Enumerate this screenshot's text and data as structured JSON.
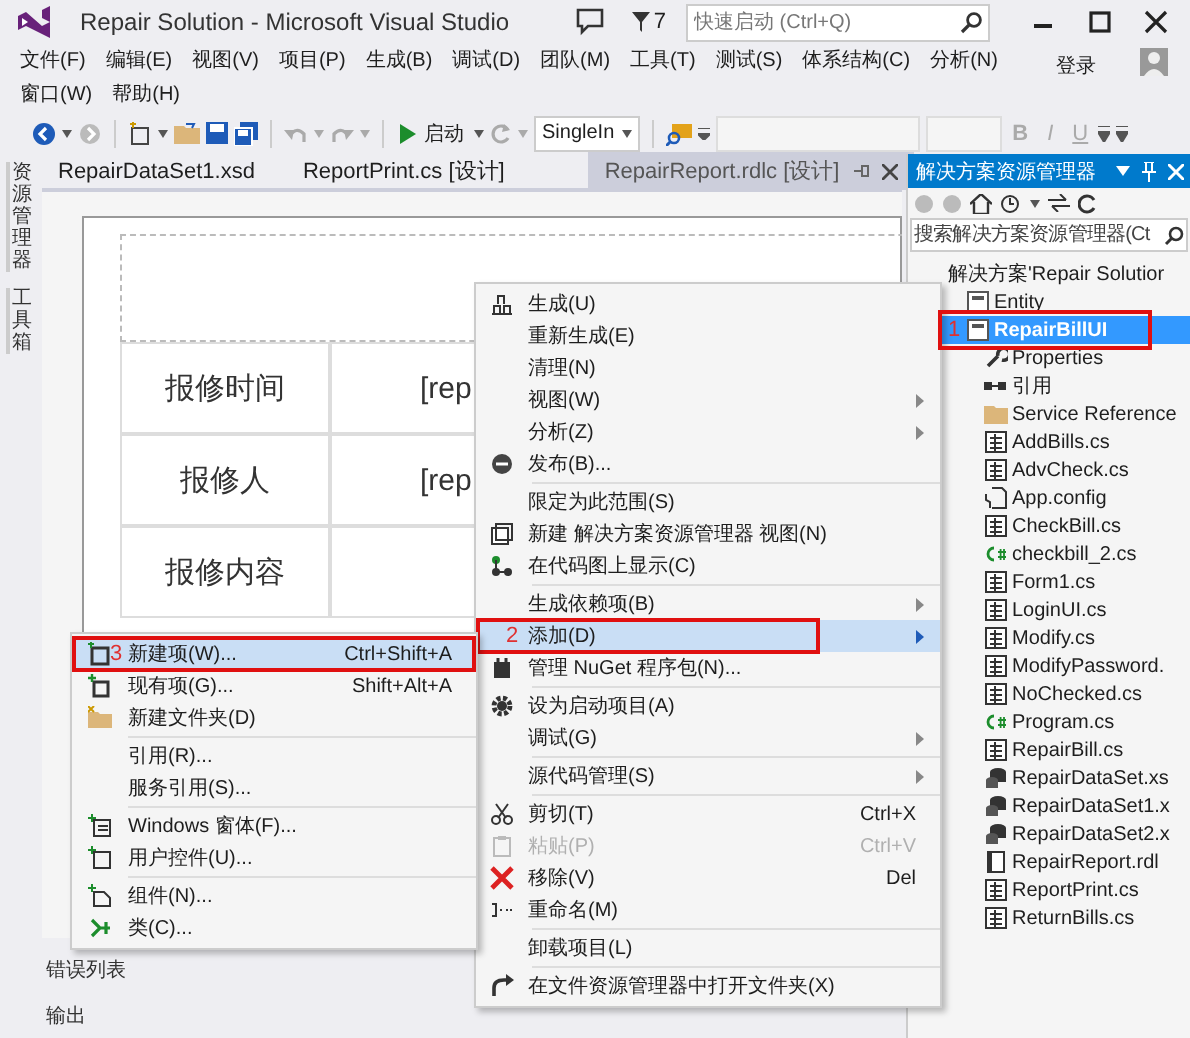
{
  "window": {
    "title": "Repair Solution - Microsoft Visual Studio",
    "notification_count": "7",
    "quick_launch": {
      "placeholder": "快速启动 (Ctrl+Q)"
    }
  },
  "menu_bar": [
    "文件(F)",
    "编辑(E)",
    "视图(V)",
    "项目(P)",
    "生成(B)",
    "调试(D)",
    "团队(M)",
    "工具(T)",
    "测试(S)",
    "体系结构(C)",
    "分析(N)",
    "窗口(W)",
    "帮助(H)"
  ],
  "sign_in": "登录",
  "toolbar": {
    "start_label": "启动",
    "configuration": "SingleIn",
    "format_buttons": [
      "B",
      "I",
      "U"
    ]
  },
  "side_tabs": [
    "资源管理器",
    "工具箱"
  ],
  "document_tabs": [
    {
      "label": "RepairDataSet1.xsd",
      "selected": false
    },
    {
      "label": "ReportPrint.cs [设计]",
      "selected": false
    },
    {
      "label": "RepairReport.rdlc [设计]",
      "selected": true
    }
  ],
  "report": {
    "rows": [
      {
        "label": "报修时间",
        "value": "[rep"
      },
      {
        "label": "报修人",
        "value": "[rep"
      },
      {
        "label": "报修内容"
      }
    ]
  },
  "bottom_panels": [
    "错误列表",
    "输出"
  ],
  "solution_explorer": {
    "title": "解决方案资源管理器",
    "search": {
      "placeholder": "搜索解决方案资源管理器(Ct"
    },
    "tree": [
      {
        "label": "解决方案'Repair Solutior",
        "selected": false,
        "children": [
          {
            "kind": "project",
            "label": "Entity",
            "selected": false
          },
          {
            "kind": "project",
            "label": "RepairBillUI",
            "selected": true,
            "marker": "1",
            "children": [
              {
                "kind": "properties",
                "label": "Properties",
                "selected": false
              },
              {
                "kind": "references",
                "label": "引用",
                "selected": false
              },
              {
                "kind": "folder",
                "label": "Service Reference",
                "selected": false
              },
              {
                "kind": "form",
                "label": "AddBills.cs",
                "selected": false
              },
              {
                "kind": "form",
                "label": "AdvCheck.cs",
                "selected": false
              },
              {
                "kind": "config",
                "label": "App.config",
                "selected": false
              },
              {
                "kind": "form",
                "label": "CheckBill.cs",
                "selected": false
              },
              {
                "kind": "csharp",
                "label": "checkbill_2.cs",
                "selected": false
              },
              {
                "kind": "form",
                "label": "Form1.cs",
                "selected": false
              },
              {
                "kind": "form",
                "label": "LoginUI.cs",
                "selected": false
              },
              {
                "kind": "form",
                "label": "Modify.cs",
                "selected": false
              },
              {
                "kind": "form",
                "label": "ModifyPassword.",
                "selected": false
              },
              {
                "kind": "form",
                "label": "NoChecked.cs",
                "selected": false
              },
              {
                "kind": "csharp",
                "label": "Program.cs",
                "selected": false
              },
              {
                "kind": "form",
                "label": "RepairBill.cs",
                "selected": false
              },
              {
                "kind": "dataset",
                "label": "RepairDataSet.xs",
                "selected": false
              },
              {
                "kind": "dataset",
                "label": "RepairDataSet1.x",
                "selected": false
              },
              {
                "kind": "dataset",
                "label": "RepairDataSet2.x",
                "selected": false
              },
              {
                "kind": "report",
                "label": "RepairReport.rdl",
                "selected": false
              },
              {
                "kind": "form",
                "label": "ReportPrint.cs",
                "selected": false
              },
              {
                "kind": "form",
                "label": "ReturnBills.cs",
                "selected": false
              }
            ]
          }
        ]
      }
    ]
  },
  "context_menu": {
    "items": [
      {
        "kind": "item",
        "label": "生成(U)",
        "selected": false,
        "disabled": false,
        "has_submenu": false
      },
      {
        "kind": "item",
        "label": "重新生成(E)",
        "selected": false,
        "disabled": false,
        "has_submenu": false
      },
      {
        "kind": "item",
        "label": "清理(N)",
        "selected": false,
        "disabled": false,
        "has_submenu": false
      },
      {
        "kind": "item",
        "label": "视图(W)",
        "selected": false,
        "disabled": false,
        "has_submenu": true
      },
      {
        "kind": "item",
        "label": "分析(Z)",
        "selected": false,
        "disabled": false,
        "has_submenu": true
      },
      {
        "kind": "item",
        "label": "发布(B)...",
        "selected": false,
        "disabled": false,
        "has_submenu": false
      },
      {
        "kind": "separator"
      },
      {
        "kind": "item",
        "label": "限定为此范围(S)",
        "selected": false,
        "disabled": false,
        "has_submenu": false
      },
      {
        "kind": "item",
        "label": "新建 解决方案资源管理器 视图(N)",
        "selected": false,
        "disabled": false,
        "has_submenu": false
      },
      {
        "kind": "item",
        "label": "在代码图上显示(C)",
        "selected": false,
        "disabled": false,
        "has_submenu": false
      },
      {
        "kind": "separator"
      },
      {
        "kind": "item",
        "label": "生成依赖项(B)",
        "selected": false,
        "disabled": false,
        "has_submenu": true
      },
      {
        "kind": "item",
        "label": "添加(D)",
        "selected": true,
        "disabled": false,
        "has_submenu": true,
        "marker": "2"
      },
      {
        "kind": "item",
        "label": "管理 NuGet 程序包(N)...",
        "selected": false,
        "disabled": false,
        "has_submenu": false
      },
      {
        "kind": "separator"
      },
      {
        "kind": "item",
        "label": "设为启动项目(A)",
        "selected": false,
        "disabled": false,
        "has_submenu": false
      },
      {
        "kind": "item",
        "label": "调试(G)",
        "selected": false,
        "disabled": false,
        "has_submenu": true
      },
      {
        "kind": "separator"
      },
      {
        "kind": "item",
        "label": "源代码管理(S)",
        "selected": false,
        "disabled": false,
        "has_submenu": true
      },
      {
        "kind": "separator"
      },
      {
        "kind": "item",
        "label": "剪切(T)",
        "shortcut": "Ctrl+X",
        "selected": false,
        "disabled": false,
        "has_submenu": false
      },
      {
        "kind": "item",
        "label": "粘贴(P)",
        "shortcut": "Ctrl+V",
        "selected": false,
        "disabled": true,
        "has_submenu": false
      },
      {
        "kind": "item",
        "label": "移除(V)",
        "shortcut": "Del",
        "selected": false,
        "disabled": false,
        "has_submenu": false
      },
      {
        "kind": "item",
        "label": "重命名(M)",
        "selected": false,
        "disabled": false,
        "has_submenu": false
      },
      {
        "kind": "separator"
      },
      {
        "kind": "item",
        "label": "卸载项目(L)",
        "selected": false,
        "disabled": false,
        "has_submenu": false
      },
      {
        "kind": "separator"
      },
      {
        "kind": "item",
        "label": "在文件资源管理器中打开文件夹(X)",
        "selected": false,
        "disabled": false,
        "has_submenu": false
      }
    ]
  },
  "add_submenu": {
    "items": [
      {
        "kind": "item",
        "label": "新建项(W)...",
        "shortcut": "Ctrl+Shift+A",
        "selected": true,
        "disabled": false,
        "marker": "3"
      },
      {
        "kind": "item",
        "label": "现有项(G)...",
        "shortcut": "Shift+Alt+A",
        "selected": false,
        "disabled": false
      },
      {
        "kind": "item",
        "label": "新建文件夹(D)",
        "selected": false,
        "disabled": false
      },
      {
        "kind": "separator"
      },
      {
        "kind": "item",
        "label": "引用(R)...",
        "selected": false,
        "disabled": false
      },
      {
        "kind": "item",
        "label": "服务引用(S)...",
        "selected": false,
        "disabled": false
      },
      {
        "kind": "separator"
      },
      {
        "kind": "item",
        "label": "Windows 窗体(F)...",
        "selected": false,
        "disabled": false
      },
      {
        "kind": "item",
        "label": "用户控件(U)...",
        "selected": false,
        "disabled": false
      },
      {
        "kind": "separator"
      },
      {
        "kind": "item",
        "label": "组件(N)...",
        "selected": false,
        "disabled": false
      },
      {
        "kind": "item",
        "label": "类(C)...",
        "selected": false,
        "disabled": false
      }
    ]
  }
}
